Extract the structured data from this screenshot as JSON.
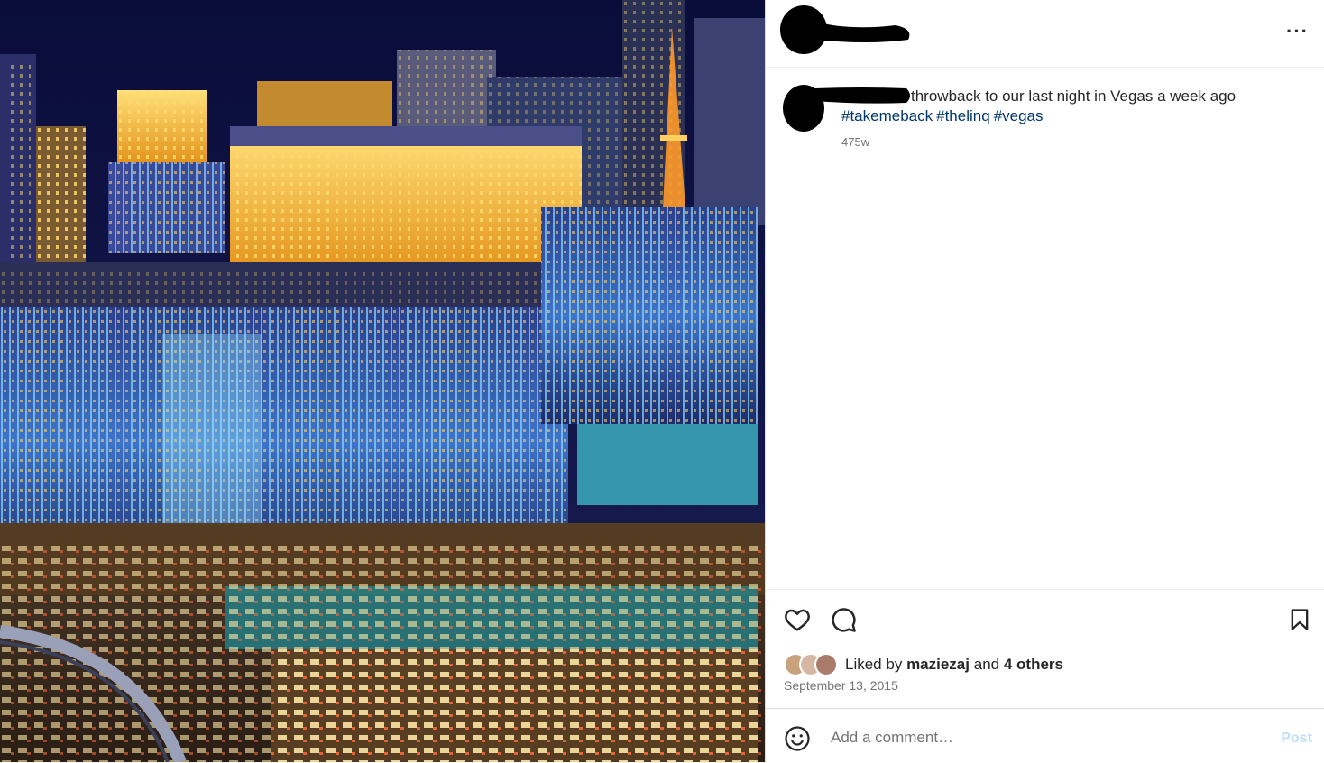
{
  "post": {
    "image_alt": "Las Vegas at night aerial view",
    "caption_text": "throwback to our last night in Vegas a week ago",
    "hashtags": [
      "#takemeback",
      "#thelinq",
      "#vegas"
    ],
    "age": "475w"
  },
  "header": {
    "more_label": "···"
  },
  "actions": {
    "like_icon": "heart-icon",
    "comment_icon": "comment-icon",
    "save_icon": "bookmark-icon"
  },
  "likes": {
    "prefix": "Liked by",
    "user": "maziezaj",
    "conjunction": "and",
    "others": "4 others"
  },
  "date": "September 13, 2015",
  "comment": {
    "placeholder": "Add a comment…",
    "post_label": "Post"
  },
  "colors": {
    "link": "#00376b",
    "post_disabled": "#c0dffd",
    "secondary_text": "#737373"
  }
}
